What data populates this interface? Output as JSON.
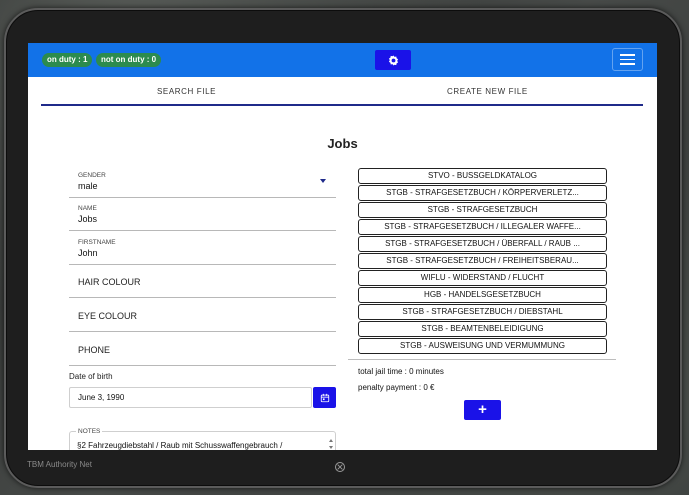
{
  "topbar": {
    "on_duty": "on duty : 1",
    "not_on_duty": "not on duty : 0",
    "center_icon": "gear-icon",
    "menu_icon": "hamburger-icon",
    "accent": "#1272e8",
    "button_color": "#1a12e8"
  },
  "tabs": [
    {
      "label": "SEARCH FILE"
    },
    {
      "label": "CREATE NEW FILE"
    }
  ],
  "page": {
    "title": "Jobs"
  },
  "form": {
    "gender": {
      "label": "GENDER",
      "value": "male"
    },
    "name": {
      "label": "NAME",
      "value": "Jobs"
    },
    "firstname": {
      "label": "FIRSTNAME",
      "value": "John"
    },
    "hair_colour": {
      "placeholder": "HAIR COLOUR"
    },
    "eye_colour": {
      "placeholder": "EYE COLOUR"
    },
    "phone": {
      "placeholder": "PHONE"
    },
    "dob": {
      "label": "Date of birth",
      "value": "June 3, 1990"
    },
    "notes": {
      "label": "NOTES",
      "value": "§2 Fahrzeugdiebstahl / Raub mit Schusswaffengebrauch /"
    }
  },
  "laws": [
    "STVO - BUSSGELDKATALOG",
    "STGB - STRAFGESETZBUCH / KÖRPERVERLETZ...",
    "STGB - STRAFGESETZBUCH",
    "STGB - STRAFGESETZBUCH / ILLEGALER WAFFE...",
    "STGB - STRAFGESETZBUCH / ÜBERFALL / RAUB ...",
    "STGB - STRAFGESETZBUCH / FREIHEITSBERAU...",
    "WIFLU - WIDERSTAND / FLUCHT",
    "HGB - HANDELSGESETZBUCH",
    "STGB - STRAFGESETZBUCH / DIEBSTAHL",
    "STGB - BEAMTENBELEIDIGUNG",
    "STGB - AUSWEISUNG UND VERMUMMUNG"
  ],
  "summary": {
    "jail": "total jail time : 0 minutes",
    "penalty": "penalty payment : 0 €"
  },
  "add_button": {
    "label": "+"
  },
  "footer": {
    "brand": "TBM Authority Net",
    "home_icon": "close-circle-icon"
  }
}
